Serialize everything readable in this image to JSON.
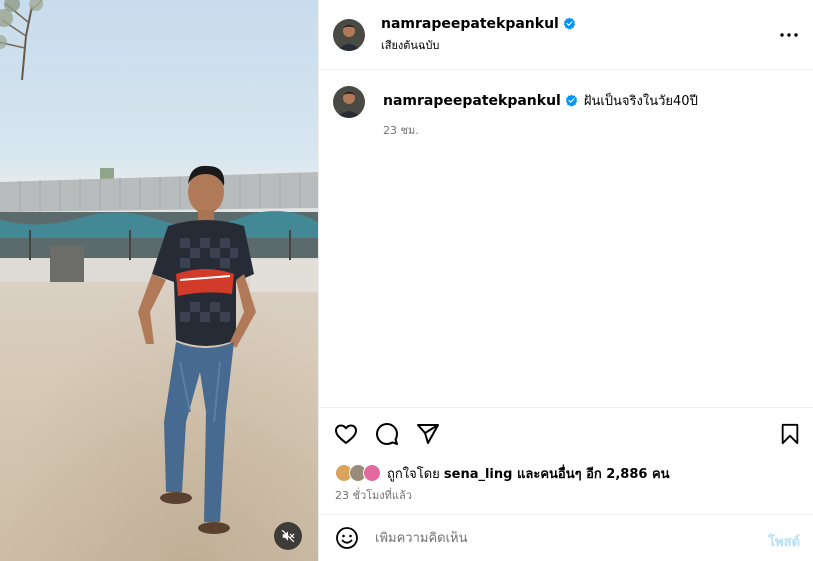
{
  "post": {
    "username": "namrapeepatekpankul",
    "audio_label": "เสียงต้นฉบับ",
    "caption": "ฝันเป็นจริงในวัย40ปี",
    "caption_time": "23 ชม.",
    "likes_prefix": "ถูกใจโดย ",
    "liker_name": "sena_ling",
    "likes_mid": " และ",
    "likes_others": "คนอื่นๆ อีก 2,886 คน",
    "posted_ago": "23 ชั่วโมงที่แล้ว"
  },
  "comment": {
    "placeholder": "เพิ่มความคิดเห็น",
    "post_label": "โพสต์"
  },
  "icons": {
    "verified": "verified-badge-icon",
    "more": "more-options-icon",
    "like": "heart-icon",
    "comment": "comment-bubble-icon",
    "share": "paper-plane-icon",
    "save": "bookmark-icon",
    "emoji": "emoji-smile-icon",
    "mute": "speaker-muted-icon"
  },
  "colors": {
    "verified_blue": "#0095f6",
    "secondary_text": "#737373",
    "post_button_disabled": "#b2dffc",
    "divider": "#efefef"
  }
}
